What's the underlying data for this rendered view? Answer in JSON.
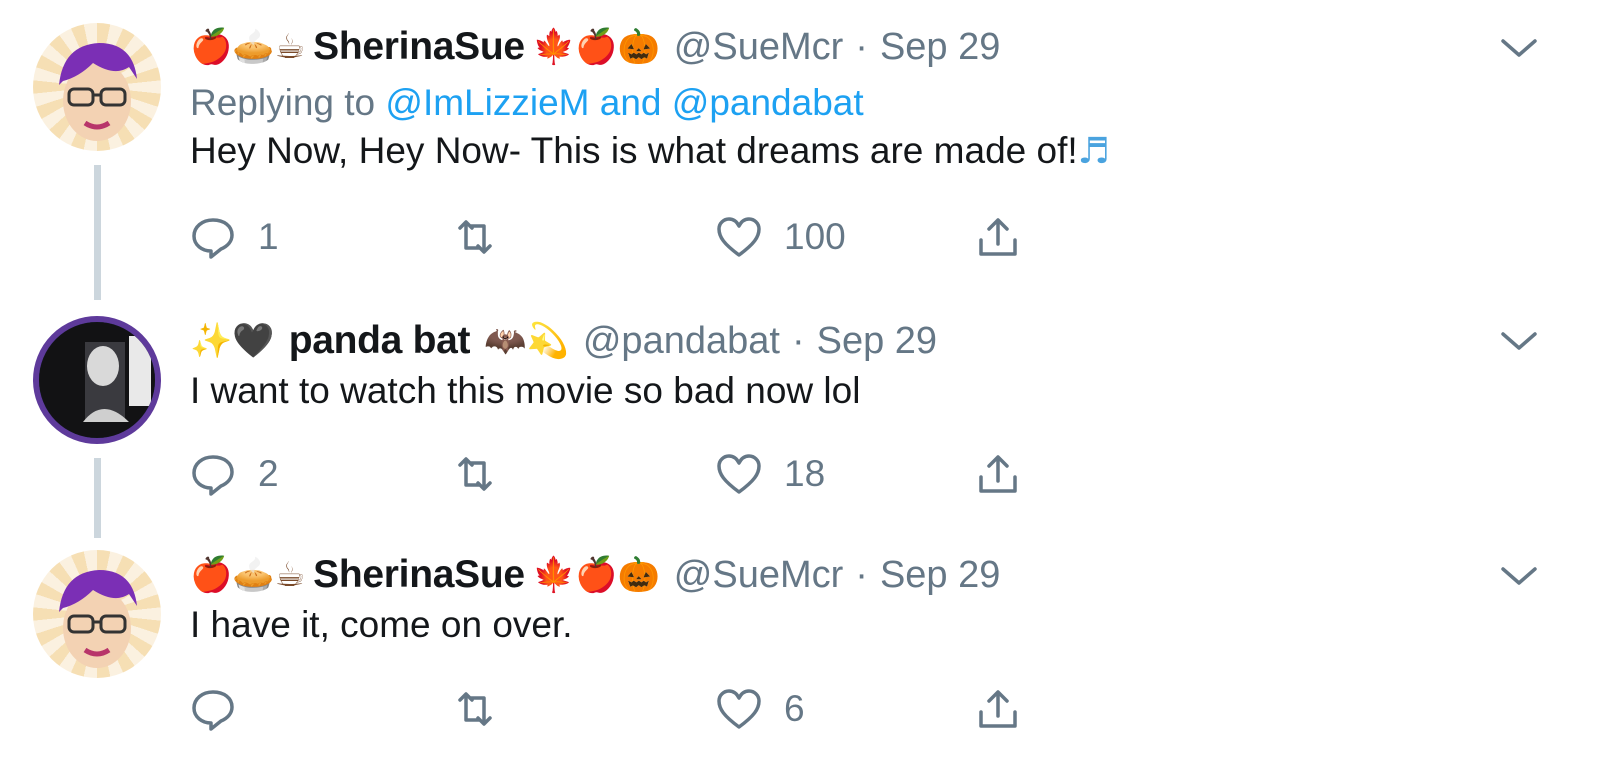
{
  "tweets": [
    {
      "emojis_before": [
        "🍎",
        "🥧",
        "☕"
      ],
      "name": "SherinaSue",
      "emojis_after": [
        "🍁",
        "🍎",
        "🎃"
      ],
      "handle": "@SueMcr",
      "separator": "·",
      "date": "Sep 29",
      "replying_prefix": "Replying to",
      "replying_to_1": "@ImLizzieM",
      "replying_and": "and",
      "replying_to_2": "@pandabat",
      "text": "Hey Now, Hey Now- This is what dreams are made of!",
      "text_emoji": "♬",
      "reply_count": "1",
      "retweet_count": "",
      "like_count": "100"
    },
    {
      "emojis_before": [
        "✨",
        "🖤"
      ],
      "name": "panda bat",
      "emojis_after": [
        "🦇",
        "💫"
      ],
      "handle": "@pandabat",
      "separator": "·",
      "date": "Sep 29",
      "text": "I want to watch this movie so bad now lol",
      "reply_count": "2",
      "retweet_count": "",
      "like_count": "18"
    },
    {
      "emojis_before": [
        "🍎",
        "🥧",
        "☕"
      ],
      "name": "SherinaSue",
      "emojis_after": [
        "🍁",
        "🍎",
        "🎃"
      ],
      "handle": "@SueMcr",
      "separator": "·",
      "date": "Sep 29",
      "text": "I have it, come on over.",
      "reply_count": "",
      "retweet_count": "",
      "like_count": "6"
    }
  ],
  "colors": {
    "link": "#1da1f2",
    "secondary_text": "#657786",
    "thread_line": "#ccd6dd",
    "primary_text": "#14171a"
  },
  "icons": [
    "reply-icon",
    "retweet-icon",
    "like-icon",
    "share-icon",
    "chevron-down-icon"
  ]
}
